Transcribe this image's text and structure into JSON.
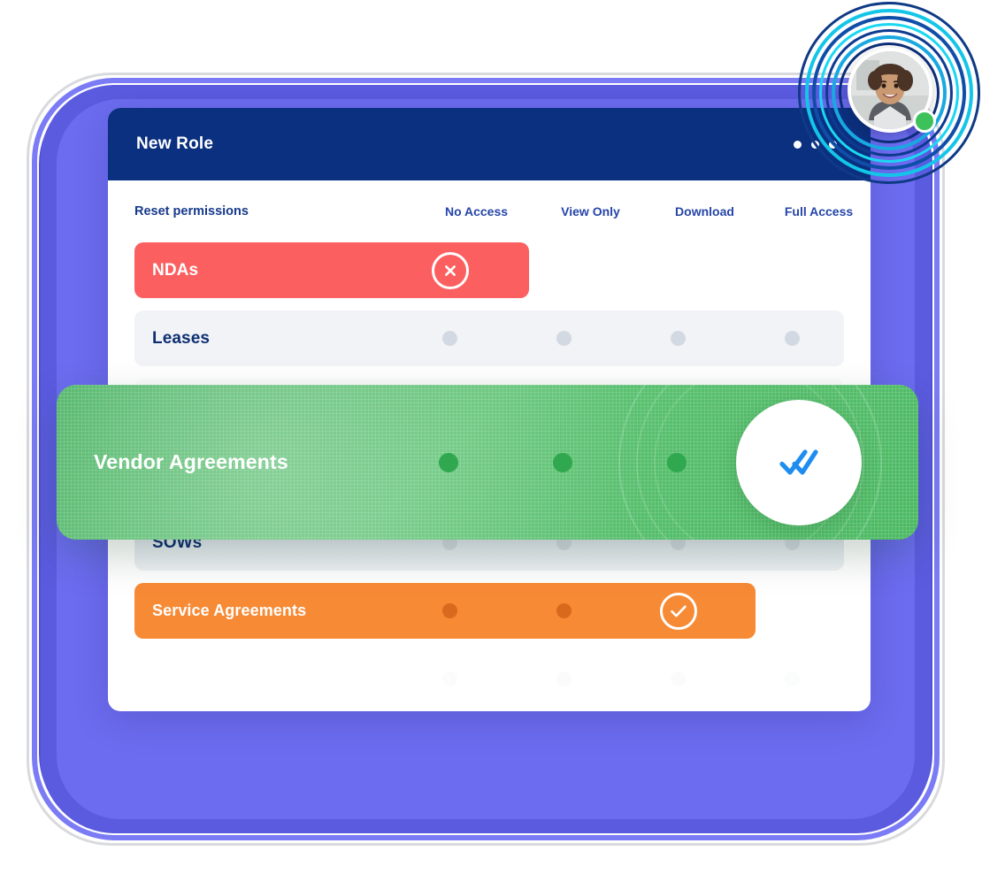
{
  "window": {
    "title": "New Role",
    "menu_icon": "kebab-menu-icon"
  },
  "table": {
    "reset_label": "Reset permissions",
    "columns": [
      "No Access",
      "View Only",
      "Download",
      "Full Access"
    ],
    "rows": [
      {
        "label": "NDAs",
        "state": "red",
        "selected": "No Access",
        "icon": "circle-x-icon",
        "dots": [
          "gray",
          "gray",
          "gray"
        ]
      },
      {
        "label": "Leases",
        "state": "muted",
        "selected": "",
        "dots": [
          "gray",
          "gray",
          "gray",
          "gray"
        ]
      },
      {
        "label": "Vendor Agreements",
        "state": "green-overlay",
        "selected": "Full Access",
        "icon": "double-check-icon",
        "dots": [
          "green",
          "green",
          "green"
        ]
      },
      {
        "label": "SOWs",
        "state": "shadowed",
        "selected": "",
        "dots": [
          "gray",
          "gray",
          "gray",
          "gray"
        ]
      },
      {
        "label": "Service Agreements",
        "state": "orange",
        "selected": "Download",
        "icon": "circle-check-icon",
        "dots": [
          "orange",
          "orange"
        ]
      }
    ]
  },
  "avatar": {
    "status": "online",
    "status_color": "#3cc15b",
    "image": "user-photo"
  },
  "colors": {
    "header_navy": "#0b3080",
    "red_row": "#fc5f5f",
    "orange_row": "#f78a35",
    "green_panel": "#4cb963",
    "dot_gray": "#d3d9e2",
    "accent_blue": "#1f8df0",
    "frame_purple": "#6c6cf0",
    "frame_cyan": "#19d6ee"
  }
}
